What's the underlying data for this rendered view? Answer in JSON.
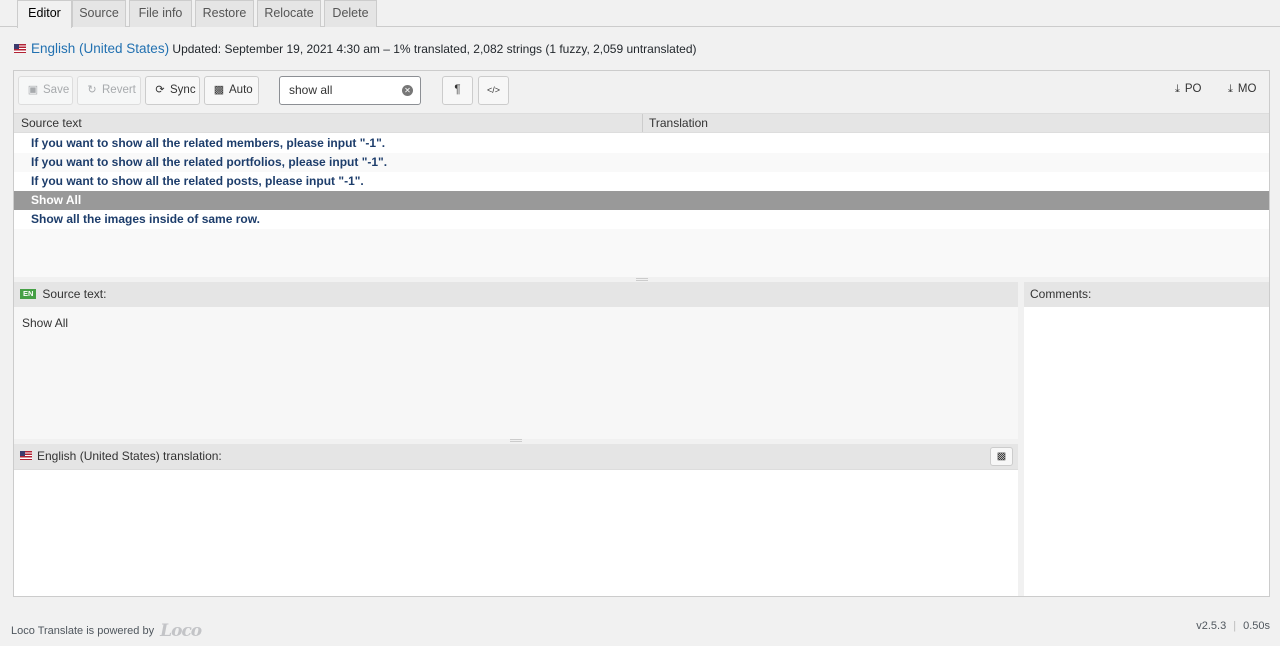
{
  "tabs": [
    {
      "label": "Editor",
      "active": true
    },
    {
      "label": "Source"
    },
    {
      "label": "File info"
    },
    {
      "label": "Restore"
    },
    {
      "label": "Relocate"
    },
    {
      "label": "Delete"
    }
  ],
  "locale": {
    "name": "English (United States)",
    "meta": "Updated: September 19, 2021 4:30 am – 1% translated, 2,082 strings (1 fuzzy, 2,059 untranslated)"
  },
  "toolbar": {
    "save_label": "Save",
    "revert_label": "Revert",
    "sync_label": "Sync",
    "auto_label": "Auto",
    "search_value": "show all",
    "pilcrow_label": "¶",
    "code_label": "</>",
    "po_label": "PO",
    "mo_label": "MO"
  },
  "grid": {
    "col_source": "Source text",
    "col_translation": "Translation",
    "rows": [
      "If you want to show all the related members, please input \"-1\".",
      "If you want to show all the related portfolios, please input \"-1\".",
      "If you want to show all the related posts, please input \"-1\".",
      "Show All",
      "Show all the images inside of same row."
    ],
    "selected_index": 3
  },
  "source_pane": {
    "badge": "EN",
    "label": "Source text:",
    "value": "Show All"
  },
  "translation_pane": {
    "label": "English (United States) translation:"
  },
  "comments_pane": {
    "label": "Comments:"
  },
  "footer": {
    "powered_by": "Loco Translate is powered by",
    "logo": "Loco",
    "version": "v2.5.3",
    "timing": "0.50s"
  },
  "colors": {
    "link": "#2271b1",
    "row_text": "#1d3d6b",
    "selected_row": "#999999",
    "en_badge": "#46a046"
  }
}
